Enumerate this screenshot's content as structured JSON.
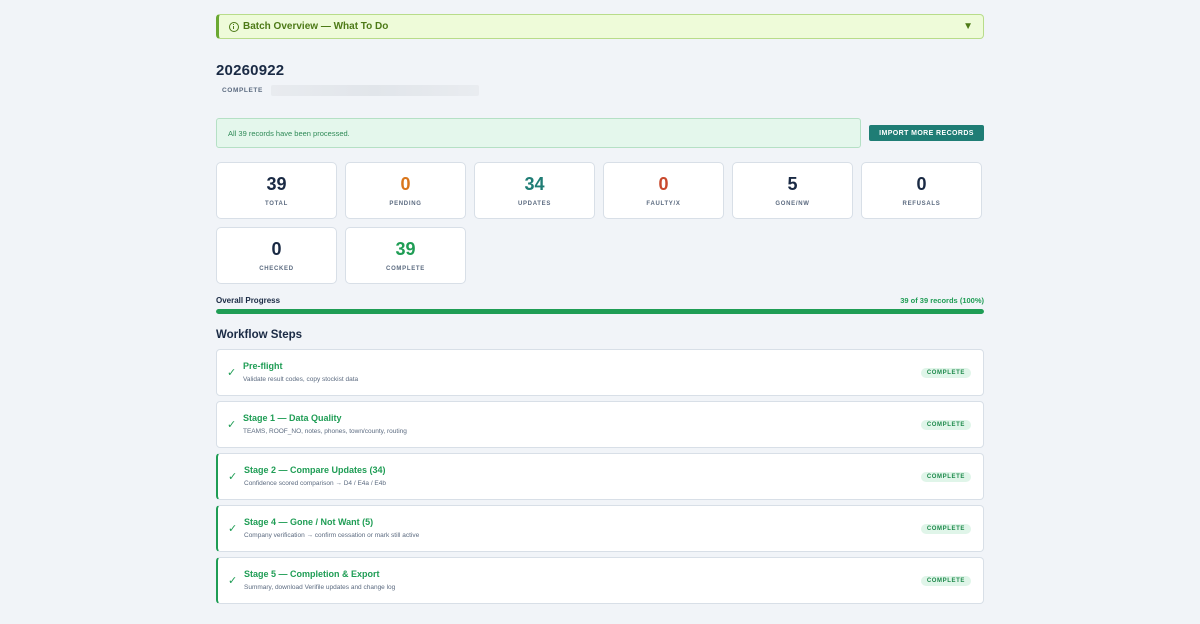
{
  "banner": {
    "title": "Batch Overview — What To Do",
    "chevron": "▼"
  },
  "batch": {
    "title": "20260922",
    "status": "COMPLETE"
  },
  "notice": {
    "text": "All 39 records have been processed.",
    "button_label": "IMPORT MORE RECORDS"
  },
  "stats": [
    {
      "value": "39",
      "label": "TOTAL",
      "color": "#1a2a44"
    },
    {
      "value": "0",
      "label": "PENDING",
      "color": "#d9761c"
    },
    {
      "value": "34",
      "label": "UPDATES",
      "color": "#1f7d75"
    },
    {
      "value": "0",
      "label": "FAULTY/X",
      "color": "#c94a2e"
    },
    {
      "value": "5",
      "label": "GONE/NW",
      "color": "#1a2a44"
    },
    {
      "value": "0",
      "label": "REFUSALS",
      "color": "#1a2a44"
    },
    {
      "value": "0",
      "label": "CHECKED",
      "color": "#1a2a44"
    },
    {
      "value": "39",
      "label": "COMPLETE",
      "color": "#1f9d55"
    }
  ],
  "progress": {
    "label": "Overall Progress",
    "count_text": "39 of 39 records (100%)",
    "percent": 100
  },
  "workflow": {
    "title": "Workflow Steps",
    "steps": [
      {
        "title": "Pre-flight",
        "desc": "Validate result codes, copy stockist data",
        "badge": "COMPLETE",
        "accent": false
      },
      {
        "title": "Stage 1 — Data Quality",
        "desc": "TEAMS, ROOF_NO, notes, phones, town/county, routing",
        "badge": "COMPLETE",
        "accent": false
      },
      {
        "title": "Stage 2 — Compare Updates (34)",
        "desc": "Confidence scored comparison → D4 / E4a / E4b",
        "badge": "COMPLETE",
        "accent": true
      },
      {
        "title": "Stage 4 — Gone / Not Want (5)",
        "desc": "Company verification → confirm cessation or mark still active",
        "badge": "COMPLETE",
        "accent": true
      },
      {
        "title": "Stage 5 — Completion & Export",
        "desc": "Summary, download Verifile updates and change log",
        "badge": "COMPLETE",
        "accent": true
      }
    ]
  }
}
